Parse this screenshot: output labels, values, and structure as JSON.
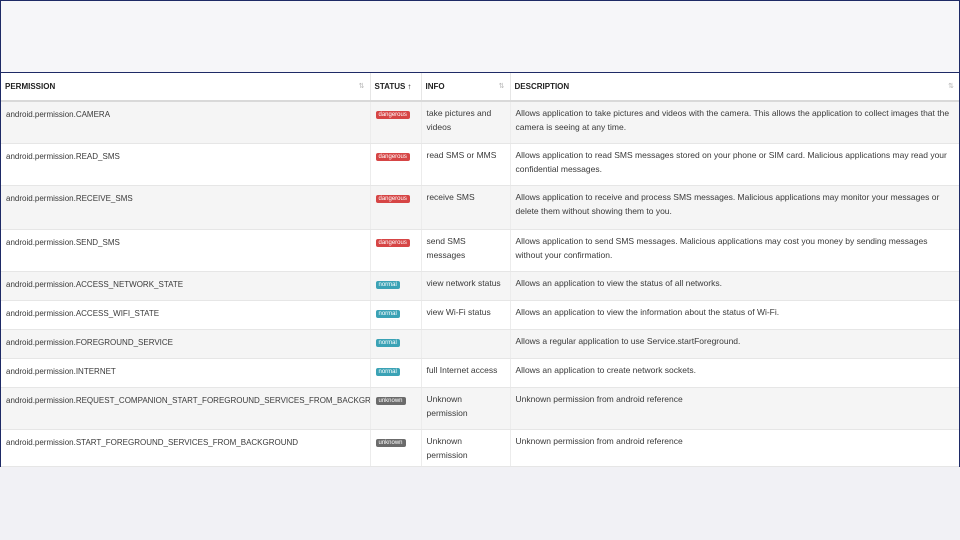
{
  "table": {
    "headers": {
      "permission": "PERMISSION",
      "status": "STATUS",
      "info": "INFO",
      "description": "DESCRIPTION"
    },
    "rows": [
      {
        "permission": "android.permission.CAMERA",
        "status": "dangerous",
        "info": "take pictures and videos",
        "description": "Allows application to take pictures and videos with the camera. This allows the application to collect images that the camera is seeing at any time."
      },
      {
        "permission": "android.permission.READ_SMS",
        "status": "dangerous",
        "info": "read SMS or MMS",
        "description": "Allows application to read SMS messages stored on your phone or SIM card. Malicious applications may read your confidential messages."
      },
      {
        "permission": "android.permission.RECEIVE_SMS",
        "status": "dangerous",
        "info": "receive SMS",
        "description": "Allows application to receive and process SMS messages. Malicious applications may monitor your messages or delete them without showing them to you."
      },
      {
        "permission": "android.permission.SEND_SMS",
        "status": "dangerous",
        "info": "send SMS messages",
        "description": "Allows application to send SMS messages. Malicious applications may cost you money by sending messages without your confirmation."
      },
      {
        "permission": "android.permission.ACCESS_NETWORK_STATE",
        "status": "normal",
        "info": "view network status",
        "description": "Allows an application to view the status of all networks."
      },
      {
        "permission": "android.permission.ACCESS_WIFI_STATE",
        "status": "normal",
        "info": "view Wi-Fi status",
        "description": "Allows an application to view the information about the status of Wi-Fi."
      },
      {
        "permission": "android.permission.FOREGROUND_SERVICE",
        "status": "normal",
        "info": "",
        "description": "Allows a regular application to use Service.startForeground."
      },
      {
        "permission": "android.permission.INTERNET",
        "status": "normal",
        "info": "full Internet access",
        "description": "Allows an application to create network sockets."
      },
      {
        "permission": "android.permission.REQUEST_COMPANION_START_FOREGROUND_SERVICES_FROM_BACKGROUND",
        "status": "unknown",
        "info": "Unknown permission",
        "description": "Unknown permission from android reference"
      },
      {
        "permission": "android.permission.START_FOREGROUND_SERVICES_FROM_BACKGROUND",
        "status": "unknown",
        "info": "Unknown permission",
        "description": "Unknown permission from android reference"
      }
    ]
  },
  "colors": {
    "dangerous": "#d64545",
    "normal": "#3aa2b5",
    "unknown": "#6b6b6b",
    "frame_border": "#1e2a66"
  },
  "icons": {
    "sort_inactive": "sort-both-icon",
    "sort_active": "sort-ascending-icon"
  }
}
